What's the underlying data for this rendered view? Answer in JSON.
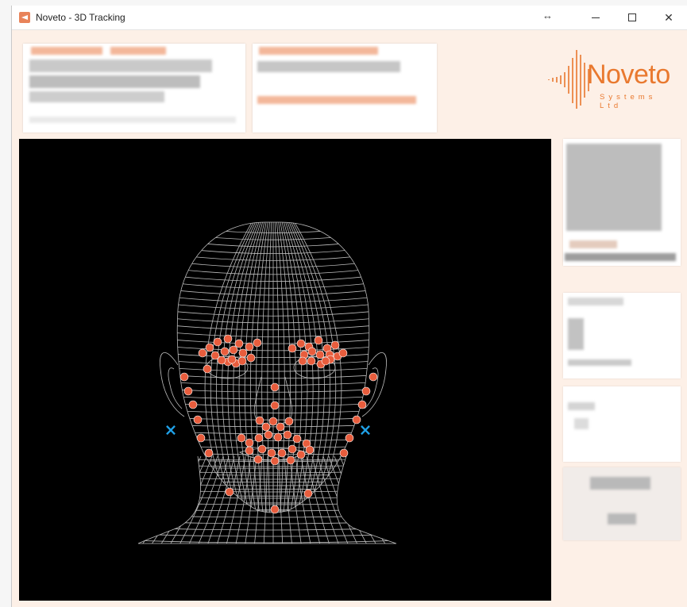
{
  "window": {
    "title": "Noveto - 3D Tracking",
    "icon": "noveto-app-icon",
    "controls": [
      "resize-arrows-icon",
      "minimize-icon",
      "maximize-icon",
      "close-icon"
    ]
  },
  "logo": {
    "wordmark": "Noveto",
    "tagline": "Systems Ltd"
  },
  "tracking_view": {
    "landmark_color": "#e85d3d",
    "marker_color": "#1fa0e6",
    "wireframe_color": "#d8d8d8",
    "background": "#000000"
  },
  "colors": {
    "accent": "#e9792f",
    "window_bg": "#fdf0e7"
  }
}
